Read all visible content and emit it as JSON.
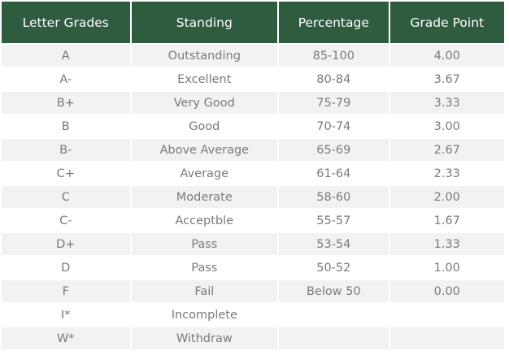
{
  "table": {
    "headers": [
      "Letter Grades",
      "Standing",
      "Percentage",
      "Grade Point"
    ],
    "rows": [
      [
        "A",
        "Outstanding",
        "85-100",
        "4.00"
      ],
      [
        "A-",
        "Excellent",
        "80-84",
        "3.67"
      ],
      [
        "B+",
        "Very Good",
        "75-79",
        "3.33"
      ],
      [
        "B",
        "Good",
        "70-74",
        "3.00"
      ],
      [
        "B-",
        "Above Average",
        "65-69",
        "2.67"
      ],
      [
        "C+",
        "Average",
        "61-64",
        "2.33"
      ],
      [
        "C",
        "Moderate",
        "58-60",
        "2.00"
      ],
      [
        "C-",
        "Acceptble",
        "55-57",
        "1.67"
      ],
      [
        "D+",
        "Pass",
        "53-54",
        "1.33"
      ],
      [
        "D",
        "Pass",
        "50-52",
        "1.00"
      ],
      [
        "F",
        "Fail",
        "Below 50",
        "0.00"
      ],
      [
        "I*",
        "Incomplete",
        "",
        ""
      ],
      [
        "W*",
        "Withdraw",
        "",
        ""
      ]
    ]
  },
  "colors": {
    "header_bg": "#2f5b3f",
    "header_text": "#ffffff",
    "row_stripe": "#f2f2f2",
    "cell_text": "#7a7a7a"
  }
}
